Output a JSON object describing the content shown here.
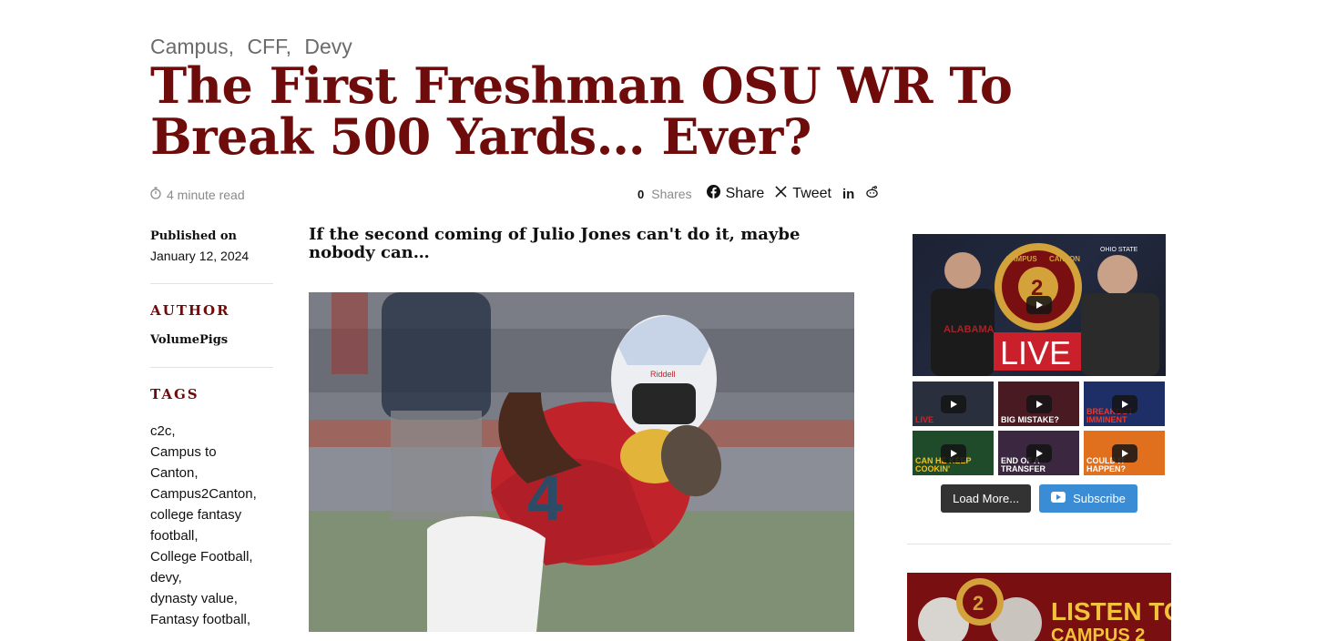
{
  "categories": [
    "Campus,",
    "CFF,",
    "Devy"
  ],
  "title": "The First Freshman OSU WR To Break 500 Yards… Ever?",
  "meta": {
    "read_time": "4 minute read",
    "shares_count": "0",
    "shares_label": "Shares",
    "share_label": "Share",
    "tweet_label": "Tweet",
    "linkedin_label": "in"
  },
  "sidebar_left": {
    "published_label": "Published on",
    "published_date": "January 12, 2024",
    "author_heading": "AUTHOR",
    "author_name": "VolumePigs",
    "tags_heading": "TAGS",
    "tags": [
      "c2c,",
      "Campus to",
      "Canton,",
      "Campus2Canton,",
      "college fantasy",
      "football,",
      "College Football,",
      "devy,",
      "dynasty value,",
      "Fantasy football,"
    ]
  },
  "article": {
    "subtitle": "If the second coming of Julio Jones can't do it, maybe nobody can…",
    "hero_jersey_number": "4",
    "hero_helmet_brand": "Riddell"
  },
  "youtube_widget": {
    "main_thumb": {
      "left_team": "ALABAMA",
      "live_text": "LIVE",
      "logo_text_top": "CAMPUS",
      "logo_text_bottom": "CANTON",
      "logo_number": "2",
      "right_team": "OHIO STATE"
    },
    "thumbs": [
      {
        "caption": "LIVE",
        "bg": "#2a2f3d",
        "accent": "#d7222a"
      },
      {
        "caption": "BIG MISTAKE?",
        "bg": "#4a1a22",
        "accent": "#ffffff"
      },
      {
        "caption": "BREAKOUT IMMINENT",
        "bg": "#1d2f66",
        "accent": "#e63a2d"
      },
      {
        "caption": "CAN HE KEEP COOKIN'",
        "bg": "#1f4b2a",
        "accent": "#f3c11b"
      },
      {
        "caption": "END OF A TRANSFER PORTAL RANKINGS",
        "bg": "#3b2740",
        "accent": "#ffffff"
      },
      {
        "caption": "COULD IT HAPPEN?",
        "bg": "#e0701e",
        "accent": "#ffffff"
      }
    ],
    "load_more_label": "Load More...",
    "subscribe_label": "Subscribe"
  },
  "banner": {
    "text_line1": "LISTEN TO",
    "text_line2": "CAMPUS 2"
  },
  "colors": {
    "brand_maroon": "#6e0b0b",
    "subscribe_blue": "#3a8cd4",
    "load_more_dark": "#333333"
  }
}
